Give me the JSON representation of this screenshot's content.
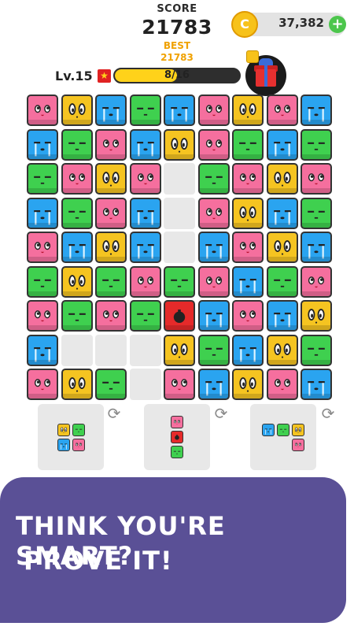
{
  "header": {
    "score_label": "SCORE",
    "score_value": "21783",
    "best_label": "BEST",
    "best_value": "21783",
    "coins": "37,382",
    "coin_icon": "coin-icon",
    "add_button": "+",
    "level": "Lv.15",
    "progress_text": "8/16",
    "progress_fraction": 0.5
  },
  "board": {
    "grid": [
      [
        "pink",
        "yellow",
        "blue",
        "green",
        "blue",
        "pink",
        "yellow",
        "pink",
        "blue"
      ],
      [
        "blue",
        "green",
        "pink",
        "blue",
        "yellow",
        "pink",
        "green",
        "blue",
        "green"
      ],
      [
        "green",
        "pink",
        "yellow",
        "pink",
        "",
        "green",
        "pink",
        "yellow",
        "pink"
      ],
      [
        "blue",
        "green",
        "pink",
        "blue",
        "",
        "pink",
        "yellow",
        "blue",
        "green"
      ],
      [
        "pink",
        "blue",
        "yellow",
        "blue",
        "",
        "blue",
        "pink",
        "yellow",
        "blue"
      ],
      [
        "green",
        "yellow",
        "green",
        "pink",
        "green",
        "pink",
        "blue",
        "green",
        "pink"
      ],
      [
        "pink",
        "green",
        "pink",
        "green",
        "bomb",
        "blue",
        "pink",
        "blue",
        "yellow"
      ],
      [
        "blue",
        "",
        "",
        "",
        "yellow",
        "green",
        "blue",
        "yellow",
        "green"
      ],
      [
        "pink",
        "yellow",
        "green",
        "",
        "pink",
        "blue",
        "yellow",
        "pink",
        "blue"
      ]
    ]
  },
  "pieces": [
    {
      "cells": [
        [
          "yellow",
          "green"
        ],
        [
          "blue",
          "pink"
        ]
      ]
    },
    {
      "cells": [
        [
          "pink"
        ],
        [
          "bomb"
        ],
        [
          "green"
        ]
      ]
    },
    {
      "cells": [
        [
          "blue",
          "green",
          "yellow"
        ],
        [
          "",
          "",
          "pink"
        ]
      ]
    }
  ],
  "colors": {
    "pink": "#f56f9e",
    "yellow": "#f5c421",
    "blue": "#2aa4f0",
    "green": "#3fd04f",
    "bomb": "#e52a2a",
    "banner": "#5a5096"
  },
  "banner": {
    "line1": "THINK YOU'RE SMART?",
    "line2": "PROVE IT!"
  }
}
